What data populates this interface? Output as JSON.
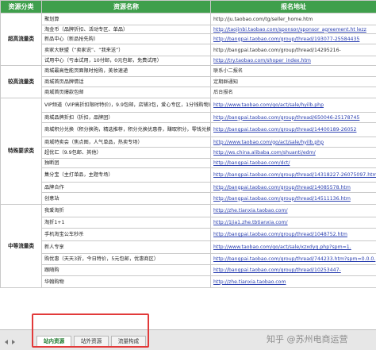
{
  "headers": {
    "category": "资源分类",
    "name": "资源名称",
    "address": "报名地址"
  },
  "categories": [
    {
      "label": "超高流量类",
      "rows": [
        {
          "name": "聚划算",
          "addr": "http://ju.taobao.com/tg/seller_home.htm",
          "link": false
        },
        {
          "name": "淘金币（品牌折扣、活动专区、单品）",
          "addr": "http://taojinbi.taobao.com/sponsor/sponsor_agreement.ht lezz",
          "link": true
        },
        {
          "name": "新品中心（新品抢先购）",
          "addr": "http://bangpai.taobao.com/group/thread/193077-25584435",
          "link": true
        },
        {
          "name": "卖家大联盟（“卖家说”、“我来送”）",
          "addr": "http://bangpai.taobao.com/group/thread/14295216-",
          "link": false
        },
        {
          "name": "试用中心（亏本试用，10付邮，0元包邮，免费试用）",
          "addr": "http://try.taobao.com/shoper_index.htm",
          "link": true
        }
      ]
    },
    {
      "label": "较高流量类",
      "rows": [
        {
          "name": "商城最高性能页面限时抢购，美妆速递",
          "addr": "联系小二报名",
          "link": false
        },
        {
          "name": "商城首页品牌情话",
          "addr": "定期群通知",
          "link": false
        },
        {
          "name": "商城首页爆款包邮",
          "addr": "后台报名",
          "link": false
        }
      ]
    },
    {
      "label": "特殊要求类",
      "rows": [
        {
          "name": "VIP频道（VIP高折扣限时特价)，9.9包邮，店铺3包，爱心专区，1分钱购物)",
          "addr": "http://www.taobao.com/go/act/sale/hyilb.php",
          "link": true
        },
        {
          "name": "商城品牌折扣（折扣，品牌团）",
          "addr": "http://bangpai.taobao.com/group/thread/650046-25178745",
          "link": true
        },
        {
          "name": "商城积分兑换（积分换购，精选推荐，积分兑换优惠券，赚取积分，零钱兑换）",
          "addr": "http://bangpai.taobao.com/group/thread/14400189-26052",
          "link": true
        },
        {
          "name": "商城特卖会（焦点图，人气单品，热卖专场）",
          "addr": "http://www.taobao.com/go/act/sale/hyilb.php",
          "link": true
        },
        {
          "name": "超优汇（9.9包邮、其他）",
          "addr": "http://ws.china.alibaba.com/shuanti/edm/",
          "link": true
        },
        {
          "name": "独断团",
          "addr": "http://bangpai.taobao.com/dct/",
          "link": true
        },
        {
          "name": "集分宝（主打单品，主题专场）",
          "addr": "http://bangpai.taobao.com/group/thread/14318227-26075097.htm?spm=0.0.0.0.112131.18",
          "link": true
        },
        {
          "name": "品牌合作",
          "addr": "http://bangpai.taobao.com/group/thread/14085578.htm",
          "link": true
        },
        {
          "name": "创意站",
          "addr": "http://bangpai.taobao.com/group/thread/14511136.htm",
          "link": true
        }
      ]
    },
    {
      "label": "中等流量类",
      "rows": [
        {
          "name": "我爱淘折",
          "addr": "http://zhe.tianxia.taobao.com/",
          "link": true
        },
        {
          "name": "淘折1+1",
          "addr": "http://1jia1.zhe.tbtianxia.com/",
          "link": true
        },
        {
          "name": "手机淘宝公车秒杀",
          "addr": "http://bangpai.taobao.com/group/thread/1048752.htm",
          "link": true
        },
        {
          "name": "新人专享",
          "addr": "http://www.taobao.com/go/act/sale/xzxdyq.php?spm=1.",
          "link": true
        },
        {
          "name": "购优惠（天天3折，今日特价，5元包邮，优惠商区）",
          "addr": "http://bangpai.taobao.com/group/thread/744233.htm?spm=0.0.0.",
          "link": true
        },
        {
          "name": "跟随购",
          "addr": "http://bangpai.taobao.com/group/thread/10253447-",
          "link": true
        },
        {
          "name": "华翰购物",
          "addr": "http://zhe.tianxia.taobao.com",
          "link": true
        }
      ]
    }
  ],
  "tabs": [
    "站内资源",
    "站外资源",
    "流量构成"
  ],
  "watermark": "知乎 @苏州电商运营",
  "colors": {
    "header_bg": "#3f9f4c",
    "highlight": "#e23a3a",
    "link": "#2a3fb0"
  }
}
